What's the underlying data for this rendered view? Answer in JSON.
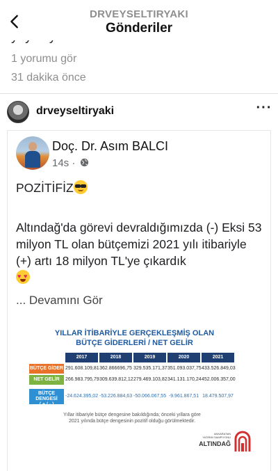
{
  "header": {
    "username": "DRVEYSELTIRYAKI",
    "title": "Gönderiler"
  },
  "previous_post": {
    "caption_fragment": "yayınlıyorum.",
    "replies_link": "1 yorumu gör",
    "time_ago": "31 dakika önce"
  },
  "post": {
    "username": "drveyseltiryaki",
    "more_icon": "ellipsis-icon",
    "fb_post": {
      "author": "Doç. Dr. Asım BALCI",
      "time": "14s",
      "separator": "·",
      "privacy_icon": "globe-icon",
      "line1": "POZİTİFİZ",
      "line1_emoji": "sunglasses-emoji",
      "body": "Altındağ'da görevi devraldığımızda (-) Eksi 53 milyon TL olan bütçemizi 2021 yılı itibariyle (+) artı 18 milyon TL'ye çıkardık",
      "body_emoji": "heart-eyes-emoji",
      "see_more": "... Devamını Gör"
    },
    "image": {
      "title_line1": "YILLAR İTİBARİYLE GERÇEKLEŞMİŞ OLAN",
      "title_line2": "BÜTÇE GİDERLERİ / NET GELİR",
      "years": [
        "2017",
        "2018",
        "2019",
        "2020",
        "2021"
      ],
      "rows": [
        {
          "label": "BÜTÇE GİDER",
          "color": "#e8722a",
          "values": [
            "291.608.109,81",
            "362.866696,75",
            "329.535.171,37",
            "351.093.037,75",
            "433.526.849,03"
          ]
        },
        {
          "label": "NET GELİR",
          "color": "#7cb342",
          "values": [
            "266.983.795,79",
            "309.639.812,12",
            "279.469.103,82",
            "341.131.170,24",
            "452.006.357,00"
          ]
        },
        {
          "label": "BÜTÇE DENGESİ",
          "label_sub": "( + / - )",
          "color": "#2f8fd3",
          "values": [
            "-24.624.395,02",
            "-53.226.884,63",
            "-50.066.067,55",
            "-9.961.867,51",
            "18.479.507,97"
          ]
        }
      ],
      "note_line1": "Yıllar itibariyle bütçe dengesine bakıldığında; önceki yıllara göre",
      "note_line2": "2021 yılında bütçe dengesinin pozitif olduğu görülmektedir.",
      "logo_small_1": "ANKARA'NIN",
      "logo_small_2": "YATIRIM SAMPİYONU",
      "logo_name": "ALTINDAĞ"
    }
  },
  "colors": {
    "header_bg": "#1f3e72",
    "gider": "#e8722a",
    "gelir": "#7cb342",
    "denge": "#2f8fd3"
  }
}
